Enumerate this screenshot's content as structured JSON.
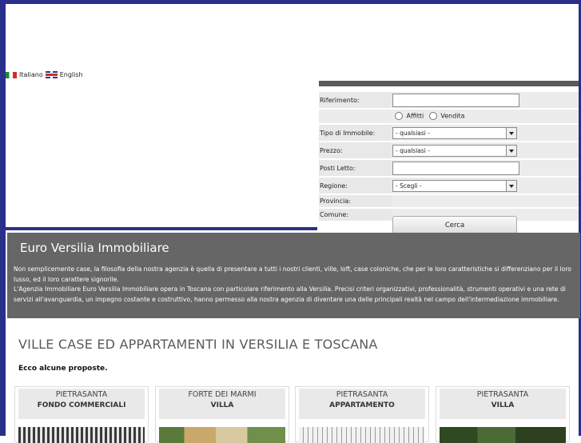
{
  "languages": [
    {
      "label": "Italiano",
      "icon": "italian-flag-icon"
    },
    {
      "label": "English",
      "icon": "uk-flag-icon"
    }
  ],
  "search": {
    "riferimento_label": "Riferimento:",
    "riferimento_value": "",
    "affitti_label": "Affitti",
    "vendita_label": "Vendita",
    "tipo_label": "Tipo di Immobile:",
    "tipo_value": "- qualsiasi -",
    "prezzo_label": "Prezzo:",
    "prezzo_value": "- qualsiasi -",
    "posti_label": "Posti Letto:",
    "posti_value": "",
    "regione_label": "Regione:",
    "regione_value": "- Scegli -",
    "provincia_label": "Provincia:",
    "comune_label": "Comune:",
    "cerca_label": "Cerca"
  },
  "intro": {
    "title": "Euro Versilia Immobiliare",
    "paragraph1": "Non semplicemente case, la filosofia della nostra agenzia è quella di presentare a tutti i nostri clienti, ville, loft, case coloniche, che per le loro caratteristiche si differenziano per il loro lusso, ed il loro carattere signorile.",
    "paragraph2": "L'Agenzia Immobiliare Euro Versilia Immobiliare opera in Toscana con particolare riferimento alla Versilia. Precisi criteri organizzativi, professionalità, strumenti operativi e una rete di servizi all'avanguardia, un impegno costante e costruttivo, hanno permesso alla nostra agenzia di diventare una delle principali realtà nel campo dell'intermediazione immobiliare."
  },
  "main": {
    "heading": "VILLE CASE ED APPARTAMENTI IN VERSILIA E TOSCANA",
    "subheading": "Ecco alcune proposte."
  },
  "listings": [
    {
      "location": "PIETRASANTA",
      "type": "FONDO COMMERCIALI"
    },
    {
      "location": "FORTE DEI MARMI",
      "type": "VILLA"
    },
    {
      "location": "PIETRASANTA",
      "type": "APPARTAMENTO"
    },
    {
      "location": "PIETRASANTA",
      "type": "VILLA"
    }
  ]
}
